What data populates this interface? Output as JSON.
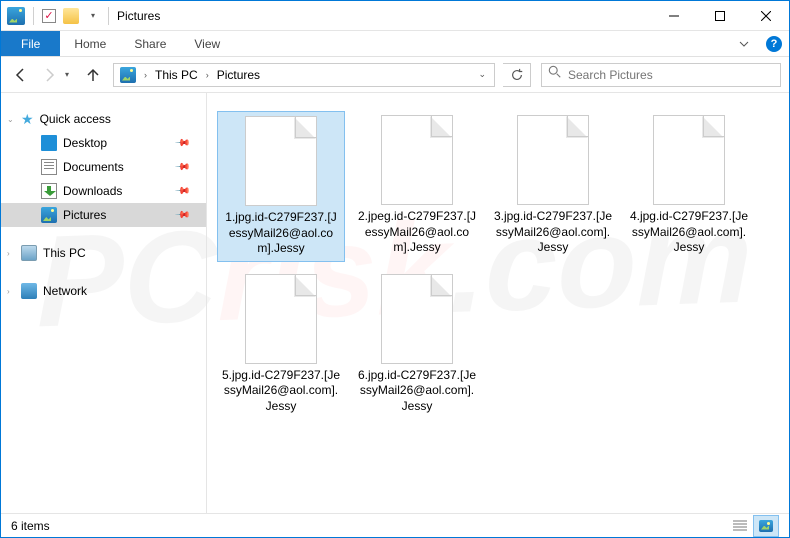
{
  "titlebar": {
    "title": "Pictures"
  },
  "ribbon": {
    "file": "File",
    "tabs": [
      "Home",
      "Share",
      "View"
    ],
    "help": "?"
  },
  "nav": {
    "breadcrumb": [
      "This PC",
      "Pictures"
    ],
    "search_placeholder": "Search Pictures"
  },
  "sidebar": {
    "quick": "Quick access",
    "items": [
      {
        "label": "Desktop",
        "pinned": true
      },
      {
        "label": "Documents",
        "pinned": true
      },
      {
        "label": "Downloads",
        "pinned": true
      },
      {
        "label": "Pictures",
        "pinned": true,
        "selected": true
      }
    ],
    "thispc": "This PC",
    "network": "Network"
  },
  "files": [
    {
      "name": "1.jpg.id-C279F237.[JessyMail26@aol.com].Jessy",
      "selected": true
    },
    {
      "name": "2.jpeg.id-C279F237.[JessyMail26@aol.com].Jessy"
    },
    {
      "name": "3.jpg.id-C279F237.[JessyMail26@aol.com].Jessy"
    },
    {
      "name": "4.jpg.id-C279F237.[JessyMail26@aol.com].Jessy"
    },
    {
      "name": "5.jpg.id-C279F237.[JessyMail26@aol.com].Jessy"
    },
    {
      "name": "6.jpg.id-C279F237.[JessyMail26@aol.com].Jessy"
    }
  ],
  "statusbar": {
    "count": "6 items"
  },
  "watermark": {
    "a": "PC",
    "b": "risk",
    "c": ".com"
  }
}
